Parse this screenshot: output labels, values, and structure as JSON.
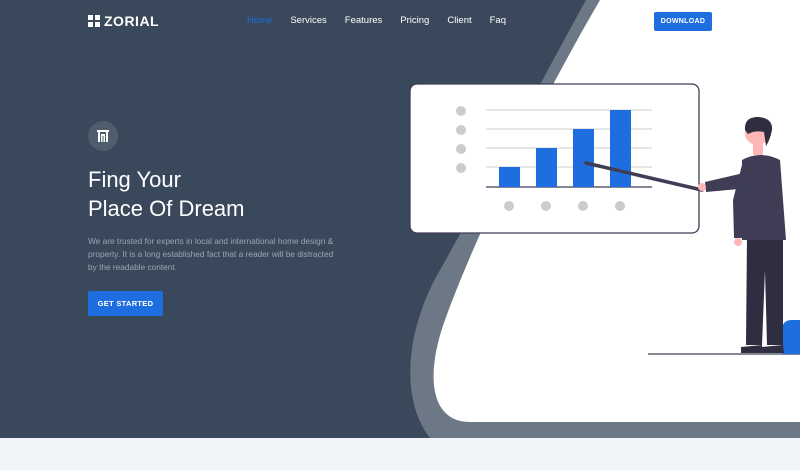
{
  "brand": {
    "name": "ZORIAL",
    "logo_icon": "grid-squares-icon"
  },
  "nav": {
    "items": [
      {
        "label": "Home",
        "active": true
      },
      {
        "label": "Services",
        "active": false
      },
      {
        "label": "Features",
        "active": false
      },
      {
        "label": "Pricing",
        "active": false
      },
      {
        "label": "Client",
        "active": false
      },
      {
        "label": "Faq",
        "active": false
      }
    ],
    "download_label": "DOWNLOAD"
  },
  "hero": {
    "badge_icon": "building-icon",
    "title_line1": "Fing Your",
    "title_line2": "Place Of Dream",
    "description": "We are trusted for experts in local and international home design & property. It is a long established fact that a reader will be distracted by the readable content.",
    "cta_label": "GET STARTED"
  },
  "colors": {
    "hero_bg": "#39485a",
    "accent": "#1f6ee0",
    "white": "#ffffff",
    "page_bg": "#f1f4f8"
  },
  "illustration": {
    "name": "presenter-with-bar-chart",
    "bar_values": [
      1,
      2,
      3,
      4
    ]
  }
}
